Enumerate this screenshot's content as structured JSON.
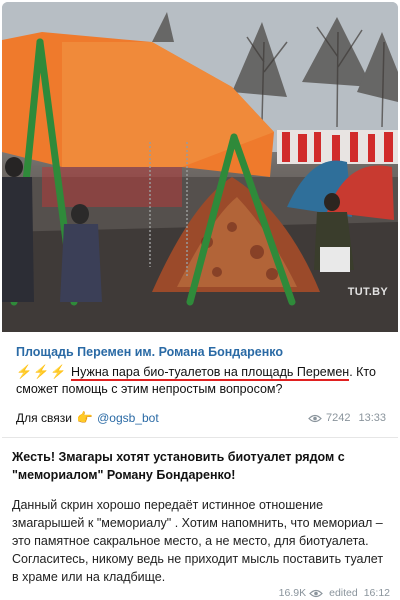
{
  "photo": {
    "watermark": "TUT.BY",
    "description_icon": "protest-tents-photo"
  },
  "quote": {
    "channel": "Площадь Перемен им. Романа Бондаренко",
    "emojis": "⚡⚡⚡",
    "text_highlighted": "Нужна пара био-туалетов на площадь Перемен",
    "text_rest": ". Кто сможет помощь с этим непростым вопросом?",
    "contact_label": "Для связи",
    "contact_icon": "pointing-hand-icon",
    "bot_handle": "@ogsb_bot",
    "views": "7242",
    "time": "13:33"
  },
  "commentary": {
    "headline": "Жесть! Змагары хотят установить биотуалет рядом с \"мемориалом\" Роману Бондаренко!",
    "body": "Данный скрин хорошо передаёт истинное отношение змагарышей к \"мемориалу\" . Хотим напомнить, что мемориал – это памятное сакральное место, а не место, для биотуалета. Согласитесь, никому ведь не приходит мысль поставить туалет в храме или на кладбище.",
    "views": "16.9K",
    "edited": "edited",
    "time": "16:12"
  },
  "colors": {
    "link": "#2a6aa5",
    "underline": "#e02020",
    "meta": "#8a949c"
  }
}
